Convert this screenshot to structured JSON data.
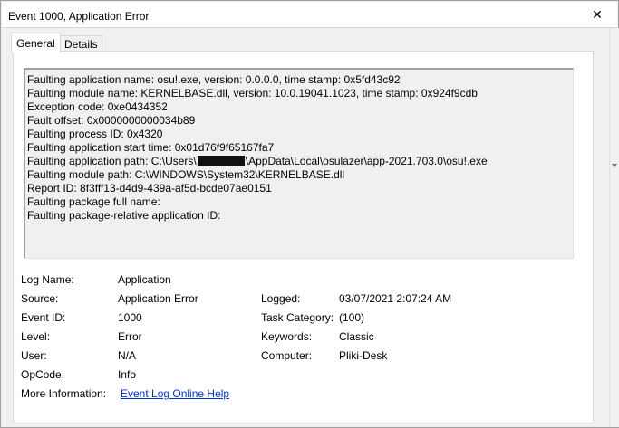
{
  "window": {
    "title": "Event 1000, Application Error",
    "close_glyph": "✕"
  },
  "tabs": [
    {
      "label": "General",
      "active": true
    },
    {
      "label": "Details",
      "active": false
    }
  ],
  "description": {
    "lines": [
      "Faulting application name: osu!.exe, version: 0.0.0.0, time stamp: 0x5fd43c92",
      "Faulting module name: KERNELBASE.dll, version: 10.0.19041.1023, time stamp: 0x924f9cdb",
      "Exception code: 0xe0434352",
      "Fault offset: 0x0000000000034b89",
      "Faulting process ID: 0x4320",
      "Faulting application start time: 0x01d76f9f65167fa7",
      "Faulting application path: C:\\Users\\",
      "Faulting module path: C:\\WINDOWS\\System32\\KERNELBASE.dll",
      "Report ID: 8f3fff13-d4d9-439a-af5d-bcde07ae0151",
      "Faulting package full name:",
      "Faulting package-relative application ID:"
    ],
    "path_suffix": "\\AppData\\Local\\osulazer\\app-2021.703.0\\osu!.exe"
  },
  "fields": {
    "log_name": {
      "label": "Log Name:",
      "value": "Application"
    },
    "source": {
      "label": "Source:",
      "value": "Application Error"
    },
    "event_id": {
      "label": "Event ID:",
      "value": "1000"
    },
    "level": {
      "label": "Level:",
      "value": "Error"
    },
    "user": {
      "label": "User:",
      "value": "N/A"
    },
    "opcode": {
      "label": "OpCode:",
      "value": "Info"
    },
    "more_info": {
      "label": "More Information:",
      "value": "Event Log Online Help"
    },
    "logged": {
      "label": "Logged:",
      "value": "03/07/2021 2:07:24 AM"
    },
    "task_category": {
      "label": "Task Category:",
      "value": "(100)"
    },
    "keywords": {
      "label": "Keywords:",
      "value": "Classic"
    },
    "computer": {
      "label": "Computer:",
      "value": "Pliki-Desk"
    }
  },
  "colors": {
    "link": "#0033cc",
    "redaction": "#111111"
  }
}
